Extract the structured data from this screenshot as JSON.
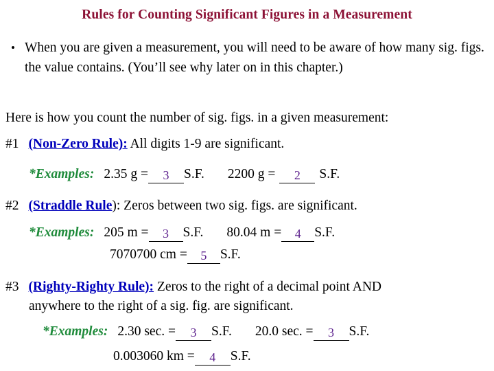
{
  "slide": {
    "title": "Rules for Counting Significant Figures in a Measurement",
    "title_color": "#8C1135",
    "rule_name_color": "#0000BB",
    "examples_label_color": "#1F8B3B",
    "answer_color": "#5B1F8C",
    "background_color": "#FFFFFF"
  },
  "bullet": {
    "marker": "•",
    "text": "When you are given a measurement, you will need to be aware of how many sig. figs. the value contains.  (You’ll see why later on in this chapter.)"
  },
  "intro": {
    "text": "Here is how you count the number of sig. figs. in a given measurement:"
  },
  "rules": [
    {
      "number": "#1",
      "name": "(Non-Zero Rule):",
      "name_trailing_plain": "",
      "description": " All digits 1-9 are significant.",
      "examples_label": "*Examples:",
      "example_rows": [
        {
          "items": [
            {
              "expression": "2.35 g =",
              "answer": "3",
              "unit_label": "S.F."
            },
            {
              "expression": "2200 g =",
              "answer": "2",
              "unit_label": "S.F."
            }
          ]
        }
      ]
    },
    {
      "number": "#2",
      "name": "(Straddle Rule",
      "name_trailing_plain": "):",
      "description": " Zeros between two sig. figs. are significant.",
      "examples_label": "*Examples:",
      "example_rows": [
        {
          "items": [
            {
              "expression": "205 m =",
              "answer": "3",
              "unit_label": "S.F."
            },
            {
              "expression": "80.04 m =",
              "answer": "4",
              "unit_label": "S.F."
            }
          ]
        },
        {
          "items": [
            {
              "expression": "7070700 cm =",
              "answer": "5",
              "unit_label": "S.F."
            }
          ]
        }
      ]
    },
    {
      "number": "#3",
      "name": "(Righty-Righty Rule):",
      "name_trailing_plain": "",
      "description": " Zeros to the right of a decimal point AND",
      "description_line2": "anywhere to the right of a sig. fig. are significant.",
      "examples_label": "*Examples:",
      "example_rows": [
        {
          "items": [
            {
              "expression": "2.30 sec. =",
              "answer": "3",
              "unit_label": "S.F."
            },
            {
              "expression": "20.0 sec. =",
              "answer": "3",
              "unit_label": "S.F."
            }
          ]
        },
        {
          "items": [
            {
              "expression": "0.003060 km =",
              "answer": "4",
              "unit_label": "S.F."
            }
          ]
        }
      ]
    }
  ]
}
